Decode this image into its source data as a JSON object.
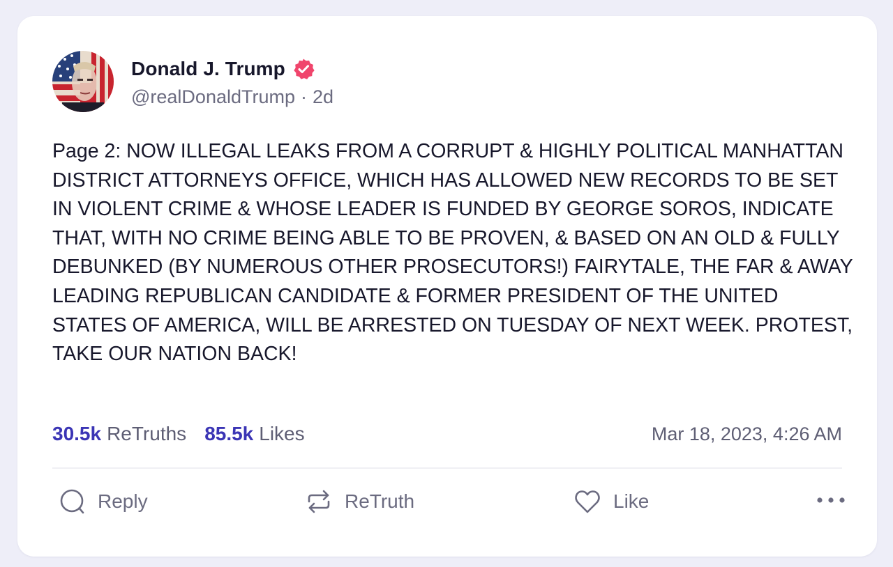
{
  "author": {
    "name": "Donald J. Trump",
    "handle": "@realDonaldTrump",
    "age": "2d",
    "verified": true
  },
  "post": {
    "text": "Page 2: NOW ILLEGAL LEAKS FROM A CORRUPT & HIGHLY POLITICAL MANHATTAN DISTRICT ATTORNEYS OFFICE, WHICH HAS ALLOWED NEW RECORDS TO BE SET IN VIOLENT CRIME & WHOSE LEADER IS FUNDED BY GEORGE SOROS, INDICATE THAT, WITH NO CRIME BEING ABLE TO BE PROVEN, & BASED ON AN OLD & FULLY DEBUNKED (BY NUMEROUS OTHER PROSECUTORS!) FAIRYTALE, THE FAR & AWAY LEADING REPUBLICAN CANDIDATE & FORMER PRESIDENT OF THE UNITED STATES OF AMERICA, WILL BE ARRESTED ON TUESDAY OF NEXT WEEK. PROTEST, TAKE OUR NATION BACK!"
  },
  "stats": {
    "retruths_count": "30.5k",
    "retruths_label": "ReTruths",
    "likes_count": "85.5k",
    "likes_label": "Likes",
    "timestamp": "Mar 18, 2023, 4:26 AM"
  },
  "actions": {
    "reply": "Reply",
    "retruth": "ReTruth",
    "like": "Like"
  },
  "icons": {
    "reply": "speech-bubble-icon",
    "retruth": "repost-arrows-icon",
    "like": "heart-icon",
    "more": "more-horizontal-icon",
    "verified": "verified-badge-icon"
  },
  "colors": {
    "page_background": "#eeeef8",
    "card_background": "#ffffff",
    "accent": "#3b35b5",
    "verified_badge": "#f0456c",
    "text_primary": "#17172b",
    "text_secondary": "#6b6b80"
  }
}
